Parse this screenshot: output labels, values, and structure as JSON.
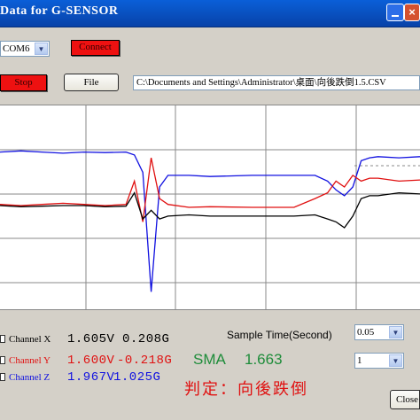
{
  "window": {
    "title": "Data for G-SENSOR",
    "close_glyph": "×"
  },
  "controls": {
    "com_port": "COM6",
    "connect_label": "Connect",
    "stop_label": "Stop",
    "file_label": "File",
    "file_path": "C:\\Documents and Settings\\Administrator\\桌面\\向後跌倒1.5.CSV",
    "sample_time_label": "Sample Time(Second)",
    "sample_time_value": "0.05",
    "second_select_value": "1",
    "close_label": "Close"
  },
  "channels": [
    {
      "label": "Channel X",
      "volt": "1.605V",
      "g": "0.208G",
      "color": "#000000"
    },
    {
      "label": "Channel Y",
      "volt": "1.600V",
      "g": "-0.218G",
      "color": "#e01010"
    },
    {
      "label": "Channel Z",
      "volt": "1.967V",
      "g": "1.025G",
      "color": "#1010e0"
    }
  ],
  "result": {
    "sma_label": "SMA",
    "sma_value": "1.663",
    "verdict": "判定：向後跌倒"
  },
  "colors": {
    "sma": "#1e8c3a",
    "verdict": "#e01010",
    "title_bar": "#0a5fd8"
  },
  "chart_data": {
    "type": "line",
    "title": "",
    "xlabel": "",
    "ylabel": "",
    "grid": true,
    "x": [
      0,
      5,
      10,
      15,
      20,
      25,
      30,
      32,
      34,
      36,
      38,
      40,
      45,
      50,
      60,
      70,
      75,
      78,
      80,
      82,
      84,
      86,
      88,
      90,
      95,
      100
    ],
    "series": [
      {
        "color": "#1010e0",
        "values": [
          0.2,
          0.22,
          0.2,
          0.18,
          0.2,
          0.19,
          0.2,
          0.15,
          -0.15,
          -2.2,
          -0.4,
          -0.2,
          -0.2,
          -0.22,
          -0.2,
          -0.2,
          -0.2,
          -0.3,
          -0.45,
          -0.55,
          -0.4,
          0.05,
          0.1,
          0.12,
          0.1,
          0.12
        ]
      },
      {
        "color": "#e01010",
        "values": [
          -0.7,
          -0.72,
          -0.7,
          -0.68,
          -0.7,
          -0.72,
          -0.7,
          -0.3,
          -1.0,
          0.1,
          -0.6,
          -0.7,
          -0.75,
          -0.74,
          -0.75,
          -0.75,
          -0.6,
          -0.5,
          -0.3,
          -0.4,
          -0.2,
          -0.3,
          -0.25,
          -0.25,
          -0.3,
          -0.28
        ]
      },
      {
        "color": "#000000",
        "values": [
          -0.72,
          -0.74,
          -0.73,
          -0.72,
          -0.72,
          -0.74,
          -0.73,
          -0.5,
          -0.95,
          -0.8,
          -0.95,
          -0.9,
          -0.88,
          -0.9,
          -0.9,
          -0.9,
          -0.88,
          -0.95,
          -1.0,
          -1.1,
          -0.9,
          -0.6,
          -0.55,
          -0.55,
          -0.5,
          -0.52
        ]
      }
    ]
  }
}
